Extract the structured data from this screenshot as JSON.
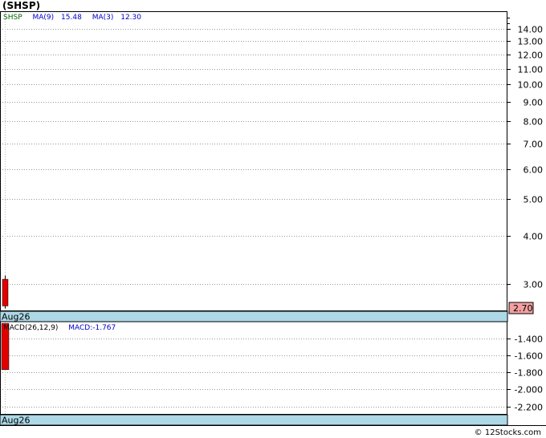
{
  "title": "(SHSP)",
  "credit": "© 12Stocks.com",
  "chart_data": [
    {
      "type": "candlestick",
      "scale": "log",
      "legend": {
        "symbol": "SHSP",
        "ma9_label": "MA(9)",
        "ma9_value": "15.48",
        "ma3_label": "MA(3)",
        "ma3_value": "12.30"
      },
      "x": [
        "Aug26"
      ],
      "candles": [
        {
          "x": "Aug26",
          "open": 3.08,
          "high": 3.15,
          "low": 2.58,
          "close": 2.62,
          "color": "#e00000"
        }
      ],
      "yticks": [
        3.0,
        4.0,
        5.0,
        6.0,
        7.0,
        8.0,
        9.0,
        10.0,
        11.0,
        12.0,
        13.0,
        14.0
      ],
      "ytick_labels": [
        "3.00",
        "4.00",
        "5.00",
        "6.00",
        "7.00",
        "8.00",
        "9.00",
        "10.00",
        "11.00",
        "12.00",
        "13.00",
        "14.00"
      ],
      "ylim": [
        2.55,
        15.5
      ],
      "last_price": "2.70",
      "xlabel": "Aug26",
      "grid": true
    },
    {
      "type": "bar",
      "legend": {
        "label": "MACD(26,12,9)",
        "macd_label": "MACD:-1.767"
      },
      "x": [
        "Aug26"
      ],
      "values": [
        -1.767
      ],
      "bar_top": -1.22,
      "yticks": [
        -1.4,
        -1.6,
        -1.8,
        -2.0,
        -2.2
      ],
      "ytick_labels": [
        "-1.400",
        "-1.600",
        "-1.800",
        "-2.000",
        "-2.200"
      ],
      "ylim": [
        -2.29,
        -1.2
      ],
      "xlabel": "Aug26",
      "grid": true
    }
  ],
  "colors": {
    "axis_strip": "#add8e6",
    "ma_text": "#0000cc",
    "symbol_text": "#006400",
    "down": "#e00000",
    "price_box": "#f4a0a0"
  }
}
